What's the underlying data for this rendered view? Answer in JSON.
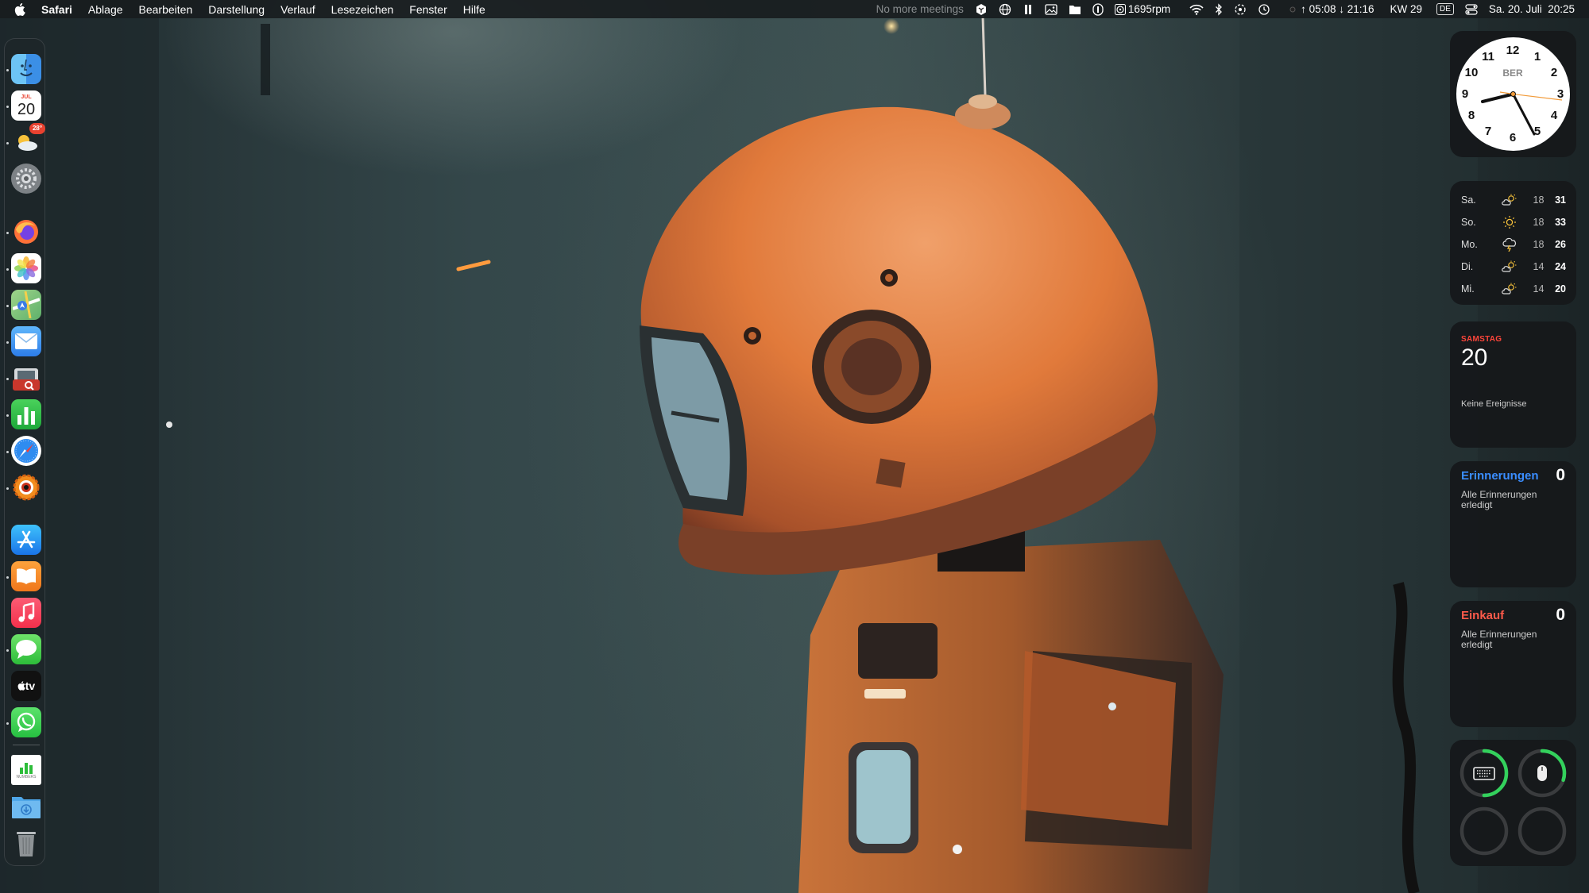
{
  "menubar": {
    "app_name": "Safari",
    "menus": [
      "Ablage",
      "Bearbeiten",
      "Darstellung",
      "Verlauf",
      "Lesezeichen",
      "Fenster",
      "Hilfe"
    ],
    "meetings_text": "No more meetings",
    "fan_speed": "1695rpm",
    "sun_times": "↑ 05:08 ↓ 21:16",
    "week": "KW 29",
    "keyboard_layout": "DE",
    "datetime": "Sa. 20. Juli  20:25",
    "icons": [
      "apple-icon",
      "dropbox-icon",
      "globe-icon",
      "pause-icon",
      "image-icon",
      "folder-icon",
      "accessibility-icon",
      "fan-icon",
      "wifi-icon",
      "bluetooth-icon",
      "airplay-icon",
      "time-machine-icon",
      "sun-icon",
      "control-center-icon"
    ]
  },
  "dock": {
    "items": [
      {
        "name": "finder",
        "icon": "finder-icon",
        "running": true
      },
      {
        "name": "calendar",
        "icon": "calendar-icon",
        "month": "JUL",
        "day": "20",
        "running": true
      },
      {
        "name": "weather",
        "icon": "weather-icon",
        "badge": "28°",
        "running": true
      },
      {
        "name": "system-settings",
        "icon": "gear-icon",
        "running": false
      },
      {
        "name": "firefox",
        "icon": "firefox-icon",
        "running": true
      },
      {
        "name": "photos",
        "icon": "photos-icon",
        "running": true
      },
      {
        "name": "maps",
        "icon": "maps-icon",
        "running": true
      },
      {
        "name": "mail",
        "icon": "mail-icon",
        "running": true
      },
      {
        "name": "image-capture",
        "icon": "camera-icon",
        "running": true
      },
      {
        "name": "numbers",
        "icon": "chart-icon",
        "running": true
      },
      {
        "name": "safari",
        "icon": "compass-icon",
        "running": true
      },
      {
        "name": "scrobbler",
        "icon": "eye-icon",
        "running": true
      },
      {
        "name": "app-store",
        "icon": "app-store-icon",
        "running": false
      },
      {
        "name": "books",
        "icon": "book-icon",
        "running": true
      },
      {
        "name": "music",
        "icon": "music-icon",
        "running": false
      },
      {
        "name": "messages",
        "icon": "messages-icon",
        "running": true
      },
      {
        "name": "apple-tv",
        "icon": "tv-icon",
        "label": "tv",
        "running": false
      },
      {
        "name": "whatsapp",
        "icon": "whatsapp-icon",
        "running": true
      },
      {
        "name": "numbers-document",
        "icon": "document-icon",
        "label": "NUMBERS",
        "running": false
      },
      {
        "name": "downloads",
        "icon": "downloads-folder-icon",
        "running": false
      },
      {
        "name": "trash",
        "icon": "trash-icon",
        "running": false
      }
    ]
  },
  "widgets": {
    "clock": {
      "city": "BER",
      "numbers": [
        "12",
        "1",
        "2",
        "3",
        "4",
        "5",
        "6",
        "7",
        "8",
        "9",
        "10",
        "11"
      ],
      "time": "20:25"
    },
    "weather": {
      "days": [
        {
          "day": "Sa.",
          "icon": "partly-cloudy-icon",
          "low": "18",
          "high": "31"
        },
        {
          "day": "So.",
          "icon": "sunny-icon",
          "low": "18",
          "high": "33"
        },
        {
          "day": "Mo.",
          "icon": "thunderstorm-icon",
          "low": "18",
          "high": "26"
        },
        {
          "day": "Di.",
          "icon": "partly-cloudy-icon",
          "low": "14",
          "high": "24"
        },
        {
          "day": "Mi.",
          "icon": "partly-cloudy-icon",
          "low": "14",
          "high": "20"
        }
      ]
    },
    "calendar": {
      "weekday": "SAMSTAG",
      "day": "20",
      "events_text": "Keine Ereignisse"
    },
    "reminders": [
      {
        "title": "Erinnerungen",
        "count": "0",
        "subtitle": "Alle Erinnerungen erledigt",
        "color": "#3a8dff"
      },
      {
        "title": "Einkauf",
        "count": "0",
        "subtitle": "Alle Erinnerungen erledigt",
        "color": "#ff5a4a"
      }
    ],
    "batteries": [
      {
        "device": "keyboard",
        "icon": "keyboard-icon",
        "level": 0.5
      },
      {
        "device": "mouse",
        "icon": "mouse-icon",
        "level": 0.3
      },
      {
        "device": "empty-1",
        "icon": "",
        "level": 0
      },
      {
        "device": "empty-2",
        "icon": "",
        "level": 0
      }
    ]
  }
}
